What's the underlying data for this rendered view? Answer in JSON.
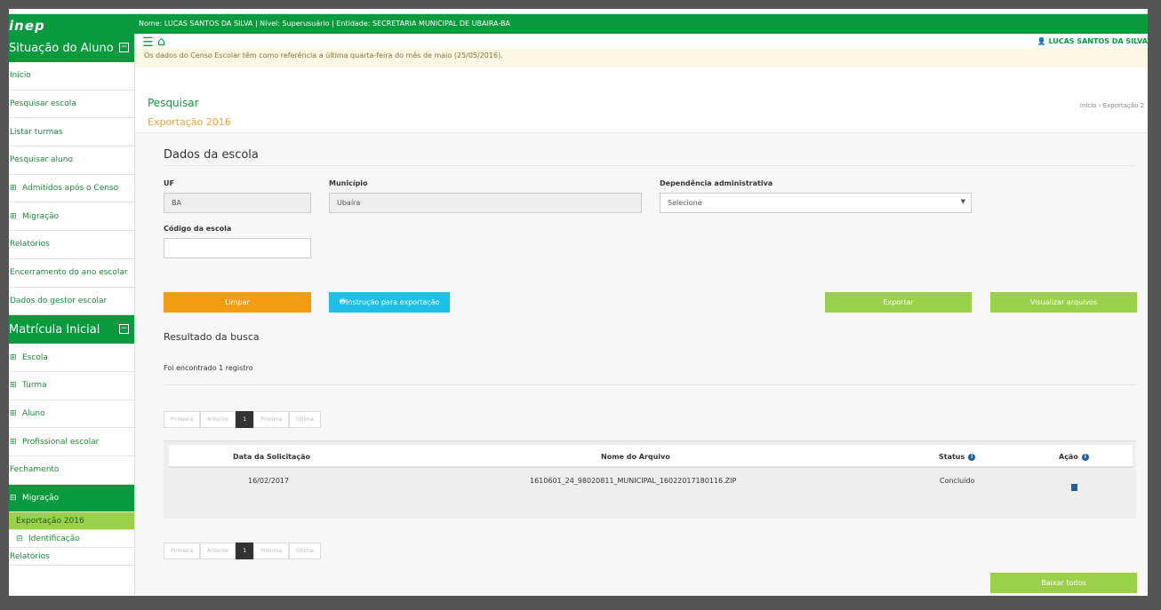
{
  "topbar": {
    "logo": "inep",
    "user_info": "Nome: LUCAS SANTOS DA SILVA | Nível: Superusuário | Entidade: SECRETARIA MUNICIPAL DE UBAIRA-BA"
  },
  "sidebar": {
    "section1": "Situação do Aluno",
    "items1": [
      "Início",
      "Pesquisar escola",
      "Listar turmas",
      "Pesquisar aluno",
      "Admitidos após o Censo",
      "Migração",
      "Relatórios",
      "Encerramento do ano escolar",
      "Dados do gestor escolar"
    ],
    "section2": "Matrícula Inicial",
    "items2": [
      "Escola",
      "Turma",
      "Aluno",
      "Profissional escolar",
      "Fechamento",
      "Migração"
    ],
    "sub_selected": "Exportação 2016",
    "sub_item": "Identificação",
    "last": "Relatórios"
  },
  "header": {
    "username": "LUCAS SANTOS DA SILVA",
    "alert": "Os dados do Censo Escolar têm como referência a última quarta-feira do mês de maio (25/05/2016)."
  },
  "page": {
    "title": "Pesquisar",
    "subtitle": "Exportação 2016",
    "breadcrumb": "Início  ›  Exportação 2"
  },
  "form": {
    "heading": "Dados da escola",
    "uf_label": "UF",
    "uf_value": "BA",
    "municipio_label": "Município",
    "municipio_value": "Ubaíra",
    "dependencia_label": "Dependência administrativa",
    "dependencia_value": "Selecione",
    "codigo_label": "Código da escola",
    "codigo_value": ""
  },
  "buttons": {
    "limpar": "Limpar",
    "instrucao": "Instrução para exportação",
    "exportar": "Exportar",
    "visualizar": "Visualizar arquivos",
    "baixar": "Baixar todos"
  },
  "results": {
    "heading": "Resultado da busca",
    "count_text": "Foi encontrado 1 registro",
    "pager": {
      "first": "Primeira",
      "prev": "Anterior",
      "page": "1",
      "next": "Próxima",
      "last": "Última"
    },
    "columns": {
      "date": "Data da Solicitação",
      "file": "Nome do Arquivo",
      "status": "Status",
      "action": "Ação"
    },
    "row": {
      "date": "16/02/2017",
      "file": "1610601_24_98020811_MUNICIPAL_16022017180116.ZIP",
      "status": "Concluído"
    }
  },
  "colors": {
    "green": "#0a9a3e",
    "lightgreen": "#9bd04a",
    "orange": "#f39c12",
    "cyan": "#1ec0e8"
  }
}
